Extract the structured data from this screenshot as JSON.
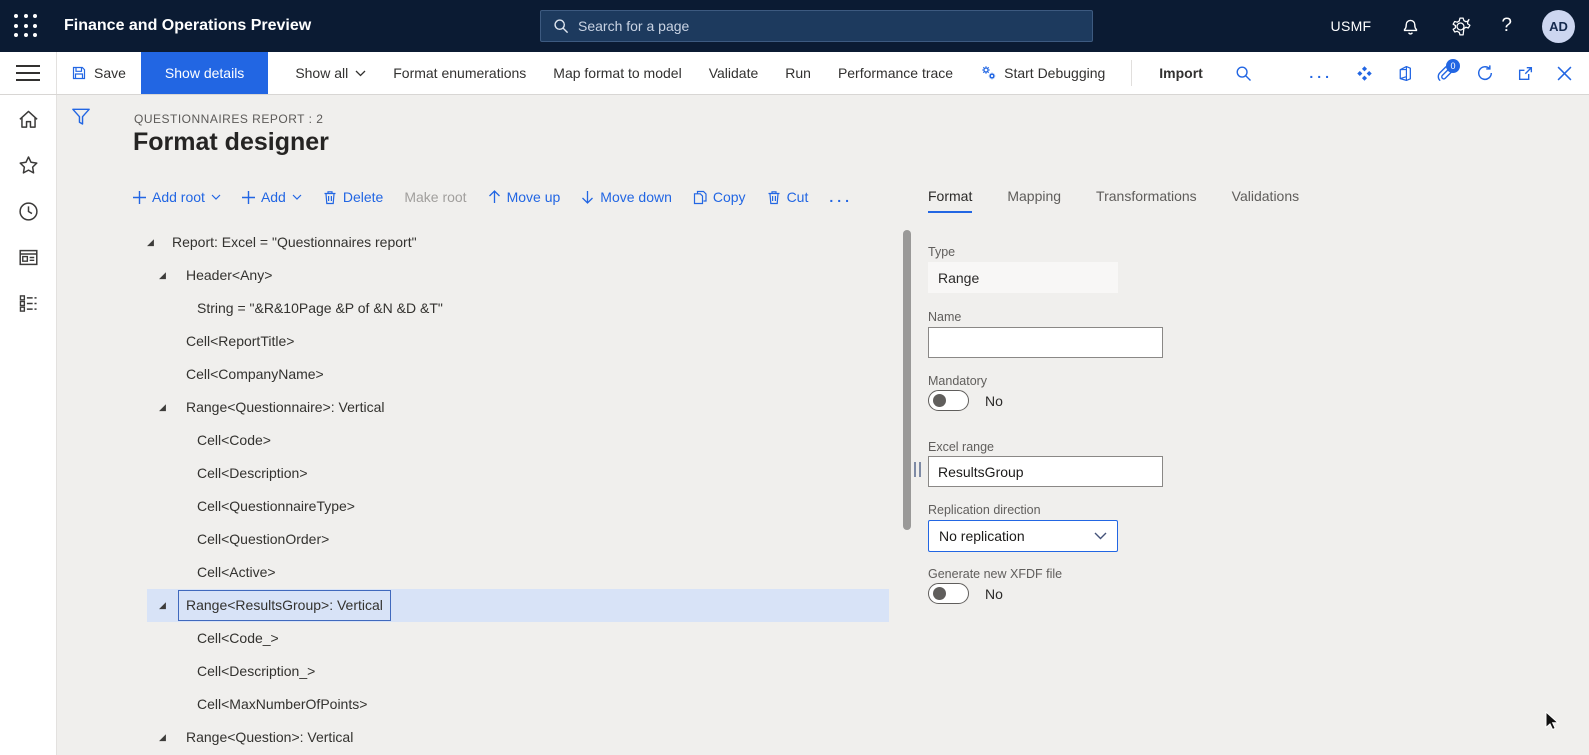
{
  "colors": {
    "accent": "#2266E3",
    "topbar_bg": "#0b1b33",
    "selected_row": "#d8e3f7"
  },
  "topbar": {
    "app_title": "Finance and Operations Preview",
    "search_placeholder": "Search for a page",
    "company": "USMF",
    "avatar_initials": "AD"
  },
  "action_bar": {
    "save": "Save",
    "show_details": "Show details",
    "show_all": "Show all",
    "format_enumerations": "Format enumerations",
    "map_format_to_model": "Map format to model",
    "validate": "Validate",
    "run": "Run",
    "performance_trace": "Performance trace",
    "start_debugging": "Start Debugging",
    "import": "Import",
    "more": "...",
    "attachments_badge": "0"
  },
  "page_header": {
    "caption": "QUESTIONNAIRES REPORT : 2",
    "title": "Format designer"
  },
  "tree_toolbar": {
    "add_root": "Add root",
    "add": "Add",
    "delete": "Delete",
    "make_root": "Make root",
    "move_up": "Move up",
    "move_down": "Move down",
    "copy": "Copy",
    "cut": "Cut",
    "more": "..."
  },
  "tree": {
    "rows": [
      {
        "label": "Report: Excel = \"Questionnaires report\"",
        "tri": 14,
        "text": 39,
        "exp": true,
        "sel": false
      },
      {
        "label": "Header<Any>",
        "tri": 26,
        "text": 53,
        "exp": true,
        "sel": false
      },
      {
        "label": "String = \"&R&10Page &P of &N &D &T\"",
        "tri": 0,
        "text": 64,
        "exp": false,
        "sel": false
      },
      {
        "label": "Cell<ReportTitle>",
        "tri": 0,
        "text": 53,
        "exp": false,
        "sel": false
      },
      {
        "label": "Cell<CompanyName>",
        "tri": 0,
        "text": 53,
        "exp": false,
        "sel": false
      },
      {
        "label": "Range<Questionnaire>: Vertical",
        "tri": 26,
        "text": 53,
        "exp": true,
        "sel": false
      },
      {
        "label": "Cell<Code>",
        "tri": 0,
        "text": 64,
        "exp": false,
        "sel": false
      },
      {
        "label": "Cell<Description>",
        "tri": 0,
        "text": 64,
        "exp": false,
        "sel": false
      },
      {
        "label": "Cell<QuestionnaireType>",
        "tri": 0,
        "text": 64,
        "exp": false,
        "sel": false
      },
      {
        "label": "Cell<QuestionOrder>",
        "tri": 0,
        "text": 64,
        "exp": false,
        "sel": false
      },
      {
        "label": "Cell<Active>",
        "tri": 0,
        "text": 64,
        "exp": false,
        "sel": false
      },
      {
        "label": "Range<ResultsGroup>: Vertical",
        "tri": 26,
        "text": 53,
        "exp": true,
        "sel": true
      },
      {
        "label": "Cell<Code_>",
        "tri": 0,
        "text": 64,
        "exp": false,
        "sel": false
      },
      {
        "label": "Cell<Description_>",
        "tri": 0,
        "text": 64,
        "exp": false,
        "sel": false
      },
      {
        "label": "Cell<MaxNumberOfPoints>",
        "tri": 0,
        "text": 64,
        "exp": false,
        "sel": false
      },
      {
        "label": "Range<Question>: Vertical",
        "tri": 26,
        "text": 53,
        "exp": true,
        "sel": false
      }
    ]
  },
  "detail_tabs": {
    "tabs": [
      "Format",
      "Mapping",
      "Transformations",
      "Validations"
    ],
    "active": "Format"
  },
  "details": {
    "type_label": "Type",
    "type_value": "Range",
    "name_label": "Name",
    "name_value": "",
    "mandatory_label": "Mandatory",
    "mandatory_value": "No",
    "excel_range_label": "Excel range",
    "excel_range_value": "ResultsGroup",
    "replication_label": "Replication direction",
    "replication_value": "No replication",
    "xfdf_label": "Generate new XFDF file",
    "xfdf_value": "No"
  }
}
